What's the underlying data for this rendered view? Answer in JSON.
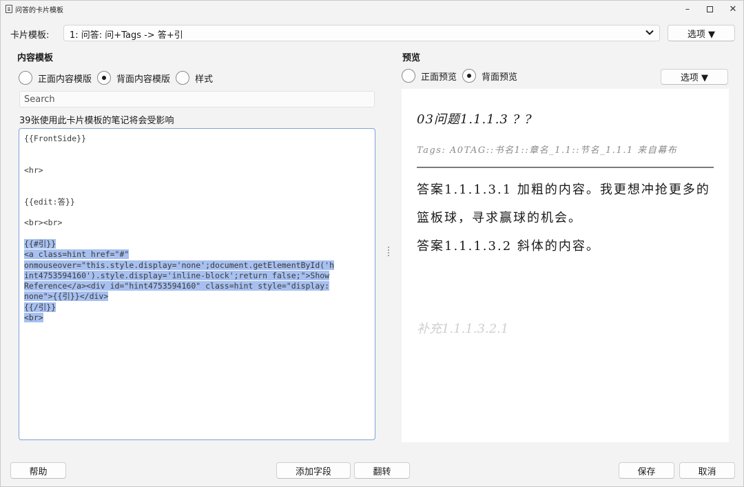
{
  "window": {
    "title": "问答的卡片模板",
    "controls": {
      "minimize": "–",
      "close": "✕"
    }
  },
  "template_row": {
    "label": "卡片模板:",
    "selected": "1: 问答: 问+Tags -> 答+引",
    "options_button": "选项 ▼"
  },
  "left": {
    "title": "内容模板",
    "radios": [
      {
        "label": "正面内容模版",
        "checked": false
      },
      {
        "label": "背面内容模版",
        "checked": true
      },
      {
        "label": "样式",
        "checked": false
      }
    ],
    "search_placeholder": "Search",
    "affected_text": "39张使用此卡片模板的笔记将会受影响",
    "editor_lines": [
      {
        "text": "{{FrontSide}}",
        "selected": false
      },
      {
        "text": "",
        "selected": false
      },
      {
        "text": "",
        "selected": false
      },
      {
        "text": "<hr>",
        "selected": false
      },
      {
        "text": "",
        "selected": false
      },
      {
        "text": "",
        "selected": false
      },
      {
        "text": "{{edit:答}}",
        "selected": false
      },
      {
        "text": "",
        "selected": false
      },
      {
        "text": "<br><br>",
        "selected": false
      },
      {
        "text": "",
        "selected": false
      },
      {
        "text": "{{#引}}",
        "selected": true
      },
      {
        "text": "<a class=hint href=\"#\"",
        "selected": true
      },
      {
        "text": "onmouseover=\"this.style.display='none';document.getElementById('h",
        "selected": true
      },
      {
        "text": "int4753594160').style.display='inline-block';return false;\">Show",
        "selected": true
      },
      {
        "text": "Reference</a><div id=\"hint4753594160\" class=hint style=\"display:",
        "selected": true
      },
      {
        "text": "none\">{{引}}</div>",
        "selected": true
      },
      {
        "text": "{{/引}}",
        "selected": true
      },
      {
        "text": "<br>",
        "selected": true
      }
    ]
  },
  "right": {
    "title": "预览",
    "radios": [
      {
        "label": "正面预览",
        "checked": false
      },
      {
        "label": "背面预览",
        "checked": true
      }
    ],
    "options_button": "选项 ▼",
    "preview": {
      "question": "03问题1.1.1.3 ? ?",
      "tags": "Tags: A0TAG::书名1::章名_1.1::节名_1.1.1 来自幕布",
      "answers": [
        "答案1.1.1.3.1 加粗的内容。我更想冲抢更多的篮板球，寻求赢球的机会。",
        "答案1.1.1.3.2 斜体的内容。"
      ],
      "supplement": "补充1.1.1.3.2.1"
    }
  },
  "bottom": {
    "help": "帮助",
    "add_field": "添加字段",
    "flip": "翻转",
    "save": "保存",
    "cancel": "取消"
  },
  "colors": {
    "selection": "#a7c0f0",
    "editor_focus_border": "#7fa2d6",
    "window_bg": "#f3f3f3"
  }
}
